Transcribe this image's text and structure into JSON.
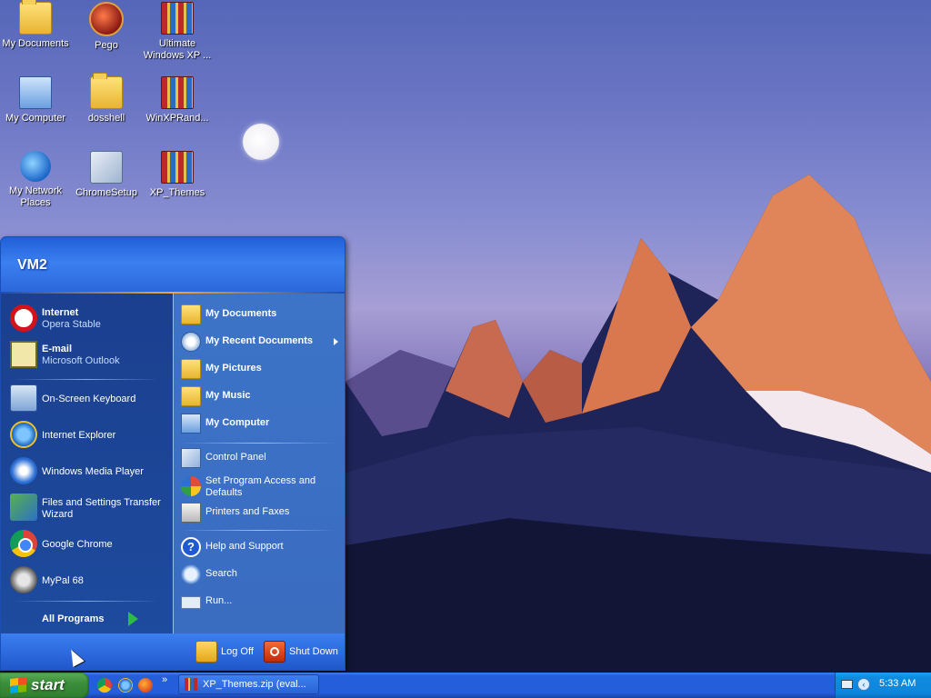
{
  "desktop": {
    "icons": [
      {
        "label": "My Documents",
        "icon": "my-documents-icon"
      },
      {
        "label": "Pego",
        "icon": "pego-icon"
      },
      {
        "label": "Ultimate Windows XP ...",
        "icon": "winrar-archive-icon"
      },
      {
        "label": "My Computer",
        "icon": "my-computer-icon"
      },
      {
        "label": "dosshell",
        "icon": "folder-icon"
      },
      {
        "label": "WinXPRand...",
        "icon": "winrar-archive-icon"
      },
      {
        "label": "My Network Places",
        "icon": "network-places-icon"
      },
      {
        "label": "ChromeSetup",
        "icon": "setup-icon"
      },
      {
        "label": "XP_Themes",
        "icon": "winrar-archive-icon"
      }
    ]
  },
  "start_menu": {
    "user": "VM2",
    "pinned": [
      {
        "title": "Internet",
        "subtitle": "Opera Stable",
        "icon": "opera-icon"
      },
      {
        "title": "E-mail",
        "subtitle": "Microsoft Outlook",
        "icon": "email-icon"
      }
    ],
    "recent": [
      {
        "label": "On-Screen Keyboard",
        "icon": "keyboard-icon"
      },
      {
        "label": "Internet Explorer",
        "icon": "internet-explorer-icon"
      },
      {
        "label": "Windows Media Player",
        "icon": "media-player-icon"
      },
      {
        "label": "Files and Settings Transfer Wizard",
        "icon": "transfer-wizard-icon"
      },
      {
        "label": "Google Chrome",
        "icon": "chrome-icon"
      },
      {
        "label": "MyPal 68",
        "icon": "mypal-icon"
      }
    ],
    "all_programs": "All Programs",
    "places": [
      {
        "label": "My Documents",
        "icon": "my-documents-icon"
      },
      {
        "label": "My Recent Documents",
        "icon": "recent-documents-icon"
      },
      {
        "label": "My Pictures",
        "icon": "my-pictures-icon"
      },
      {
        "label": "My Music",
        "icon": "my-music-icon"
      },
      {
        "label": "My Computer",
        "icon": "my-computer-icon"
      }
    ],
    "system": [
      {
        "label": "Control Panel",
        "icon": "control-panel-icon"
      },
      {
        "label": "Set Program Access and Defaults",
        "icon": "program-access-icon"
      },
      {
        "label": "Printers and Faxes",
        "icon": "printer-icon"
      }
    ],
    "help": [
      {
        "label": "Help and Support",
        "icon": "help-icon"
      },
      {
        "label": "Search",
        "icon": "search-icon"
      },
      {
        "label": "Run...",
        "icon": "run-icon"
      }
    ],
    "log_off": "Log Off",
    "shut_down": "Shut Down"
  },
  "taskbar": {
    "start_label": "start",
    "quick_launch": [
      "chrome-icon",
      "internet-explorer-icon",
      "firefox-icon"
    ],
    "more": "»",
    "task_button": "XP_Themes.zip (eval...",
    "clock": "5:33 AM"
  },
  "colors": {
    "taskbar_blue": "#245edb",
    "start_green": "#3c8f3b",
    "start_menu_left": "#1c3f8f",
    "start_menu_right": "#3d74c8",
    "tray_blue": "#0f8be0"
  }
}
